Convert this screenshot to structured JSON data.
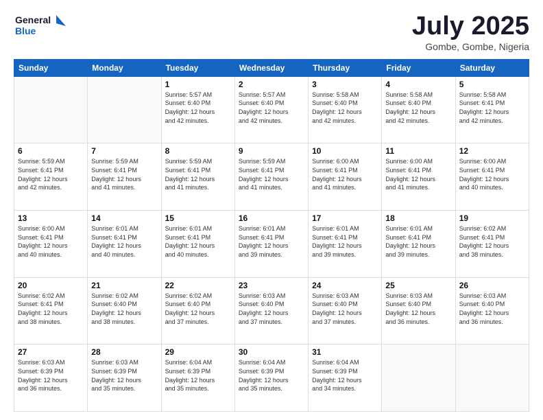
{
  "logo": {
    "line1": "General",
    "line2": "Blue"
  },
  "title": "July 2025",
  "subtitle": "Gombe, Gombe, Nigeria",
  "headers": [
    "Sunday",
    "Monday",
    "Tuesday",
    "Wednesday",
    "Thursday",
    "Friday",
    "Saturday"
  ],
  "weeks": [
    [
      {
        "day": "",
        "info": ""
      },
      {
        "day": "",
        "info": ""
      },
      {
        "day": "1",
        "info": "Sunrise: 5:57 AM\nSunset: 6:40 PM\nDaylight: 12 hours\nand 42 minutes."
      },
      {
        "day": "2",
        "info": "Sunrise: 5:57 AM\nSunset: 6:40 PM\nDaylight: 12 hours\nand 42 minutes."
      },
      {
        "day": "3",
        "info": "Sunrise: 5:58 AM\nSunset: 6:40 PM\nDaylight: 12 hours\nand 42 minutes."
      },
      {
        "day": "4",
        "info": "Sunrise: 5:58 AM\nSunset: 6:40 PM\nDaylight: 12 hours\nand 42 minutes."
      },
      {
        "day": "5",
        "info": "Sunrise: 5:58 AM\nSunset: 6:41 PM\nDaylight: 12 hours\nand 42 minutes."
      }
    ],
    [
      {
        "day": "6",
        "info": "Sunrise: 5:59 AM\nSunset: 6:41 PM\nDaylight: 12 hours\nand 42 minutes."
      },
      {
        "day": "7",
        "info": "Sunrise: 5:59 AM\nSunset: 6:41 PM\nDaylight: 12 hours\nand 41 minutes."
      },
      {
        "day": "8",
        "info": "Sunrise: 5:59 AM\nSunset: 6:41 PM\nDaylight: 12 hours\nand 41 minutes."
      },
      {
        "day": "9",
        "info": "Sunrise: 5:59 AM\nSunset: 6:41 PM\nDaylight: 12 hours\nand 41 minutes."
      },
      {
        "day": "10",
        "info": "Sunrise: 6:00 AM\nSunset: 6:41 PM\nDaylight: 12 hours\nand 41 minutes."
      },
      {
        "day": "11",
        "info": "Sunrise: 6:00 AM\nSunset: 6:41 PM\nDaylight: 12 hours\nand 41 minutes."
      },
      {
        "day": "12",
        "info": "Sunrise: 6:00 AM\nSunset: 6:41 PM\nDaylight: 12 hours\nand 40 minutes."
      }
    ],
    [
      {
        "day": "13",
        "info": "Sunrise: 6:00 AM\nSunset: 6:41 PM\nDaylight: 12 hours\nand 40 minutes."
      },
      {
        "day": "14",
        "info": "Sunrise: 6:01 AM\nSunset: 6:41 PM\nDaylight: 12 hours\nand 40 minutes."
      },
      {
        "day": "15",
        "info": "Sunrise: 6:01 AM\nSunset: 6:41 PM\nDaylight: 12 hours\nand 40 minutes."
      },
      {
        "day": "16",
        "info": "Sunrise: 6:01 AM\nSunset: 6:41 PM\nDaylight: 12 hours\nand 39 minutes."
      },
      {
        "day": "17",
        "info": "Sunrise: 6:01 AM\nSunset: 6:41 PM\nDaylight: 12 hours\nand 39 minutes."
      },
      {
        "day": "18",
        "info": "Sunrise: 6:01 AM\nSunset: 6:41 PM\nDaylight: 12 hours\nand 39 minutes."
      },
      {
        "day": "19",
        "info": "Sunrise: 6:02 AM\nSunset: 6:41 PM\nDaylight: 12 hours\nand 38 minutes."
      }
    ],
    [
      {
        "day": "20",
        "info": "Sunrise: 6:02 AM\nSunset: 6:41 PM\nDaylight: 12 hours\nand 38 minutes."
      },
      {
        "day": "21",
        "info": "Sunrise: 6:02 AM\nSunset: 6:40 PM\nDaylight: 12 hours\nand 38 minutes."
      },
      {
        "day": "22",
        "info": "Sunrise: 6:02 AM\nSunset: 6:40 PM\nDaylight: 12 hours\nand 37 minutes."
      },
      {
        "day": "23",
        "info": "Sunrise: 6:03 AM\nSunset: 6:40 PM\nDaylight: 12 hours\nand 37 minutes."
      },
      {
        "day": "24",
        "info": "Sunrise: 6:03 AM\nSunset: 6:40 PM\nDaylight: 12 hours\nand 37 minutes."
      },
      {
        "day": "25",
        "info": "Sunrise: 6:03 AM\nSunset: 6:40 PM\nDaylight: 12 hours\nand 36 minutes."
      },
      {
        "day": "26",
        "info": "Sunrise: 6:03 AM\nSunset: 6:40 PM\nDaylight: 12 hours\nand 36 minutes."
      }
    ],
    [
      {
        "day": "27",
        "info": "Sunrise: 6:03 AM\nSunset: 6:39 PM\nDaylight: 12 hours\nand 36 minutes."
      },
      {
        "day": "28",
        "info": "Sunrise: 6:03 AM\nSunset: 6:39 PM\nDaylight: 12 hours\nand 35 minutes."
      },
      {
        "day": "29",
        "info": "Sunrise: 6:04 AM\nSunset: 6:39 PM\nDaylight: 12 hours\nand 35 minutes."
      },
      {
        "day": "30",
        "info": "Sunrise: 6:04 AM\nSunset: 6:39 PM\nDaylight: 12 hours\nand 35 minutes."
      },
      {
        "day": "31",
        "info": "Sunrise: 6:04 AM\nSunset: 6:39 PM\nDaylight: 12 hours\nand 34 minutes."
      },
      {
        "day": "",
        "info": ""
      },
      {
        "day": "",
        "info": ""
      }
    ]
  ]
}
